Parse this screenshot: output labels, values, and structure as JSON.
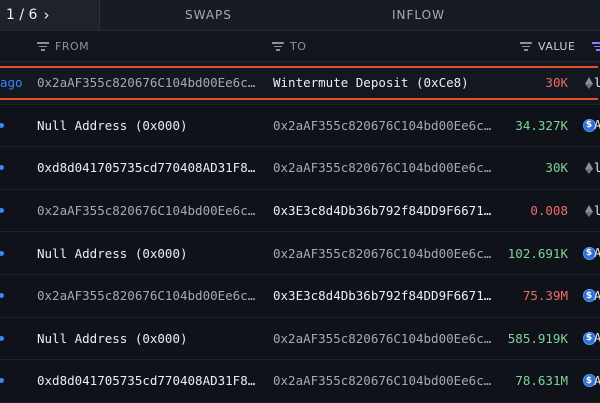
{
  "pager": {
    "label": "1 / 6",
    "next": "›"
  },
  "tabs": {
    "swaps": "SWAPS",
    "inflow": "INFLOW"
  },
  "columns": {
    "from": "FROM",
    "to": "TO",
    "value": "VALUE"
  },
  "rows": [
    {
      "time": "ago",
      "from": "0x2aAF355c820676C104bd00Ee6c…",
      "from_style": "muted",
      "to": "Wintermute Deposit (0xCe8)",
      "to_style": "bright",
      "value": "30K",
      "value_style": "neg",
      "token": "eth",
      "edge": "l"
    },
    {
      "from": "Null Address (0x000)",
      "from_style": "bright",
      "to": "0x2aAF355c820676C104bd00Ee6c…",
      "to_style": "muted",
      "value": "34.327K",
      "value_style": "pos",
      "token": "usdc",
      "edge": "A"
    },
    {
      "from": "0xd8d041705735cd770408AD31F8…",
      "from_style": "bright",
      "to": "0x2aAF355c820676C104bd00Ee6c…",
      "to_style": "muted",
      "value": "30K",
      "value_style": "pos",
      "token": "eth",
      "edge": "l"
    },
    {
      "from": "0x2aAF355c820676C104bd00Ee6c…",
      "from_style": "muted",
      "to": "0x3E3c8d4Db36b792f84DD9F6671…",
      "to_style": "bright",
      "value": "0.008",
      "value_style": "neg",
      "token": "eth",
      "edge": "l"
    },
    {
      "from": "Null Address (0x000)",
      "from_style": "bright",
      "to": "0x2aAF355c820676C104bd00Ee6c…",
      "to_style": "muted",
      "value": "102.691K",
      "value_style": "pos",
      "token": "usdc",
      "edge": "A"
    },
    {
      "from": "0x2aAF355c820676C104bd00Ee6c…",
      "from_style": "muted",
      "to": "0x3E3c8d4Db36b792f84DD9F6671…",
      "to_style": "bright",
      "value": "75.39M",
      "value_style": "neg",
      "token": "usdc",
      "edge": "A"
    },
    {
      "from": "Null Address (0x000)",
      "from_style": "bright",
      "to": "0x2aAF355c820676C104bd00Ee6c…",
      "to_style": "muted",
      "value": "585.919K",
      "value_style": "pos",
      "token": "usdc",
      "edge": "A"
    },
    {
      "from": "0xd8d041705735cd770408AD31F8…",
      "from_style": "bright",
      "to": "0x2aAF355c820676C104bd00Ee6c…",
      "to_style": "muted",
      "value": "78.631M",
      "value_style": "pos",
      "token": "usdc",
      "edge": "A"
    }
  ],
  "colors": {
    "accent": "#e0542f",
    "positive": "#7fd39a",
    "negative": "#ee6a6a",
    "link": "#3c86ff",
    "sort": "#8d7bff"
  }
}
